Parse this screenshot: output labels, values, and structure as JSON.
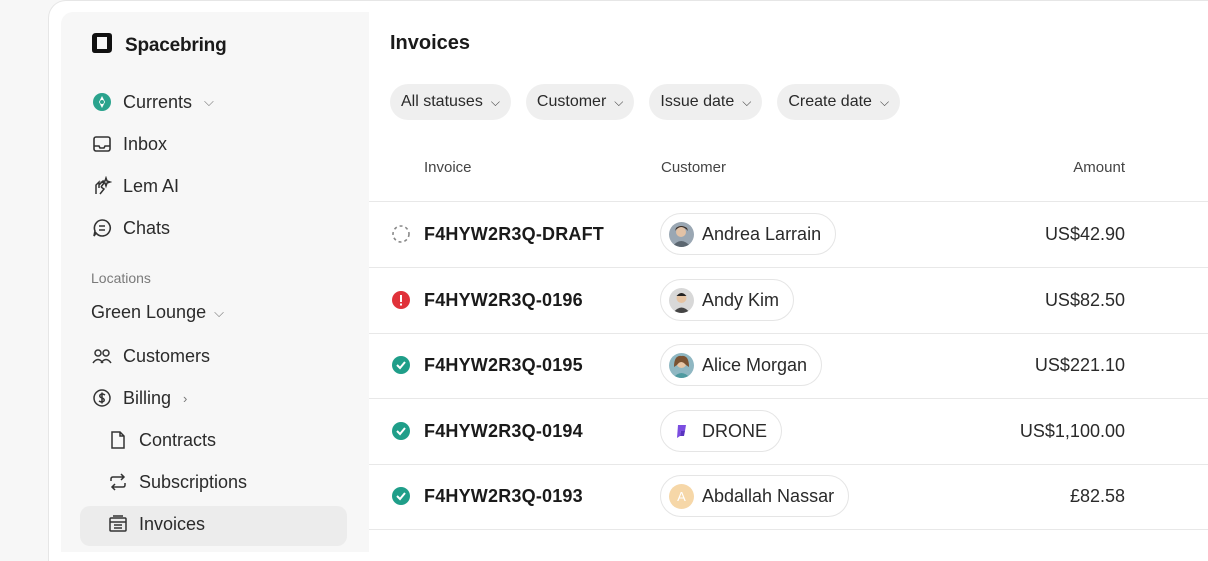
{
  "brand": {
    "name": "Spacebring"
  },
  "nav": {
    "currents": "Currents",
    "inbox": "Inbox",
    "lem_ai": "Lem AI",
    "chats": "Chats"
  },
  "locations": {
    "label": "Locations",
    "current": "Green Lounge",
    "customers": "Customers",
    "billing": "Billing",
    "contracts": "Contracts",
    "subscriptions": "Subscriptions",
    "invoices": "Invoices"
  },
  "page": {
    "title": "Invoices"
  },
  "filters": [
    "All statuses",
    "Customer",
    "Issue date",
    "Create date"
  ],
  "table": {
    "headers": {
      "invoice": "Invoice",
      "customer": "Customer",
      "amount": "Amount"
    },
    "rows": [
      {
        "status": "draft",
        "invoice": "F4HYW2R3Q-DRAFT",
        "customer": "Andrea Larrain",
        "avatar": "photo",
        "amount": "US$42.90"
      },
      {
        "status": "error",
        "invoice": "F4HYW2R3Q-0196",
        "customer": "Andy Kim",
        "avatar": "photo",
        "amount": "US$82.50"
      },
      {
        "status": "paid",
        "invoice": "F4HYW2R3Q-0195",
        "customer": "Alice Morgan",
        "avatar": "photo",
        "amount": "US$221.10"
      },
      {
        "status": "paid",
        "invoice": "F4HYW2R3Q-0194",
        "customer": "DRONE",
        "avatar": "logo",
        "amount": "US$1,100.00"
      },
      {
        "status": "paid",
        "invoice": "F4HYW2R3Q-0193",
        "customer": "Abdallah Nassar",
        "avatar": "initial",
        "initial": "A",
        "amount": "£82.58"
      }
    ]
  },
  "colors": {
    "paid": "#1f9e89",
    "error": "#e0323a",
    "draft": "#888888",
    "currents": "#2aa38d",
    "drone": "#7b4de0",
    "initial_bg": "#f6d7a8"
  }
}
